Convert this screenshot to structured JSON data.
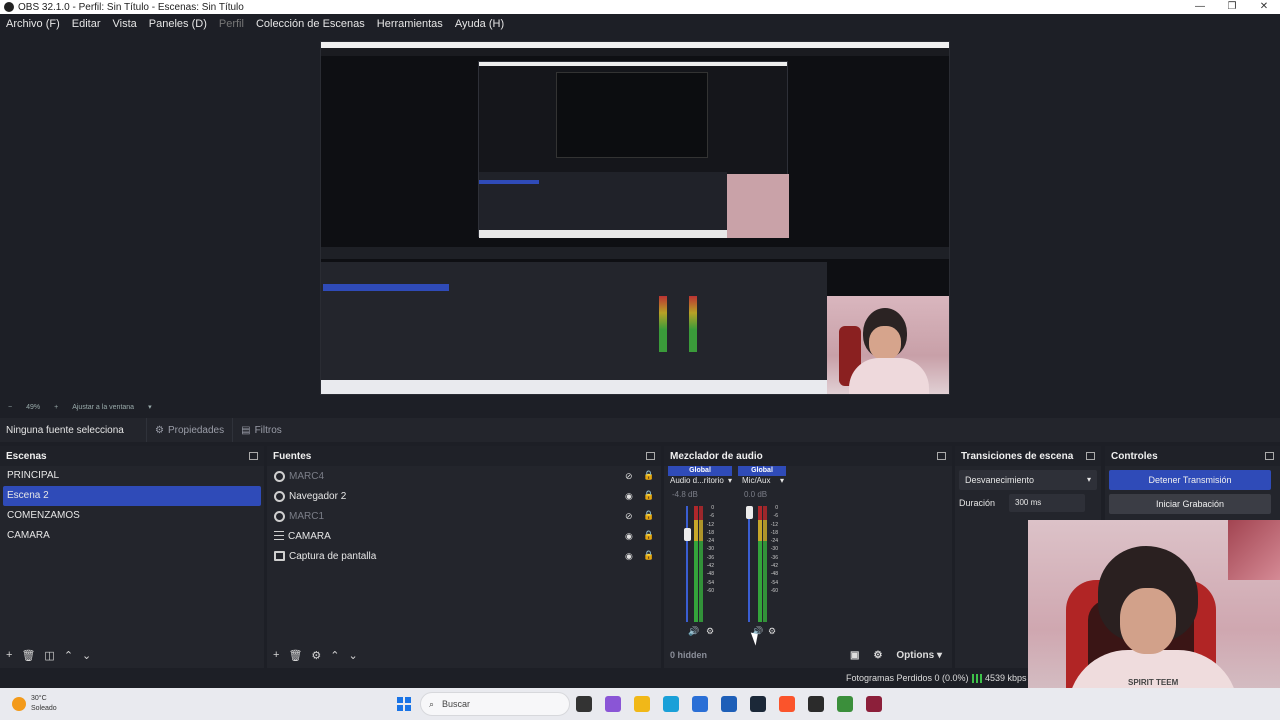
{
  "window": {
    "title": "OBS 32.1.0 - Perfil: Sin Título - Escenas: Sin Título",
    "controls": [
      "—",
      "❐",
      "✕"
    ]
  },
  "menu": {
    "items": [
      "Archivo (F)",
      "Editar",
      "Vista",
      "Paneles (D)",
      "Perfil",
      "Colección de Escenas",
      "Herramientas",
      "Ayuda (H)"
    ]
  },
  "zoom": {
    "minus": "−",
    "value": "49%",
    "plus": "+",
    "fit": "Ajustar a la ventana"
  },
  "properties_bar": {
    "source_text": "Ninguna fuente selecciona",
    "properties_label": "Propiedades",
    "filters_label": "Filtros"
  },
  "scenes": {
    "title": "Escenas",
    "items": [
      "PRINCIPAL",
      "Escena 2",
      "COMENZAMOS",
      "CAMARA"
    ],
    "selected_index": 1
  },
  "sources": {
    "title": "Fuentes",
    "items": [
      {
        "label": "MARC4",
        "type": "browser",
        "visible": false
      },
      {
        "label": "Navegador 2",
        "type": "browser",
        "visible": true
      },
      {
        "label": "MARC1",
        "type": "browser",
        "visible": false
      },
      {
        "label": "CAMARA",
        "type": "list",
        "visible": true
      },
      {
        "label": "Captura de pantalla",
        "type": "screen",
        "visible": true
      }
    ]
  },
  "mixer": {
    "title": "Mezclador de audio",
    "channels": [
      {
        "global": "Global",
        "name": "Audio d...ritorio",
        "db": "-4.8 dB",
        "fader": 0.78
      },
      {
        "global": "Global",
        "name": "Mic/Aux",
        "db": "0.0 dB",
        "fader": 0.92
      }
    ],
    "scale": [
      "0",
      "-6",
      "-12",
      "-18",
      "-24",
      "-30",
      "-36",
      "-42",
      "-48",
      "-54",
      "-60"
    ],
    "hidden_label": "0 hidden",
    "options_label": "Options"
  },
  "transitions": {
    "title": "Transiciones de escena",
    "selected": "Desvanecimiento",
    "duration_label": "Duración",
    "duration_value": "300 ms"
  },
  "controls": {
    "title": "Controles",
    "stop_stream": "Detener Transmisión",
    "start_record": "Iniciar Grabación"
  },
  "status": {
    "dropped_frames": "Fotogramas Perdidos 0 (0.0%)",
    "bitrate": "4539 kbps"
  },
  "taskbar": {
    "temperature": "30°C",
    "weather": "Soleado",
    "search_placeholder": "Buscar"
  },
  "webcam": {
    "shirt_text": "SPIRIT TEEM"
  },
  "colors": {
    "accent": "#2f4bb8",
    "panel": "#23252c",
    "background": "#1d1f26"
  }
}
